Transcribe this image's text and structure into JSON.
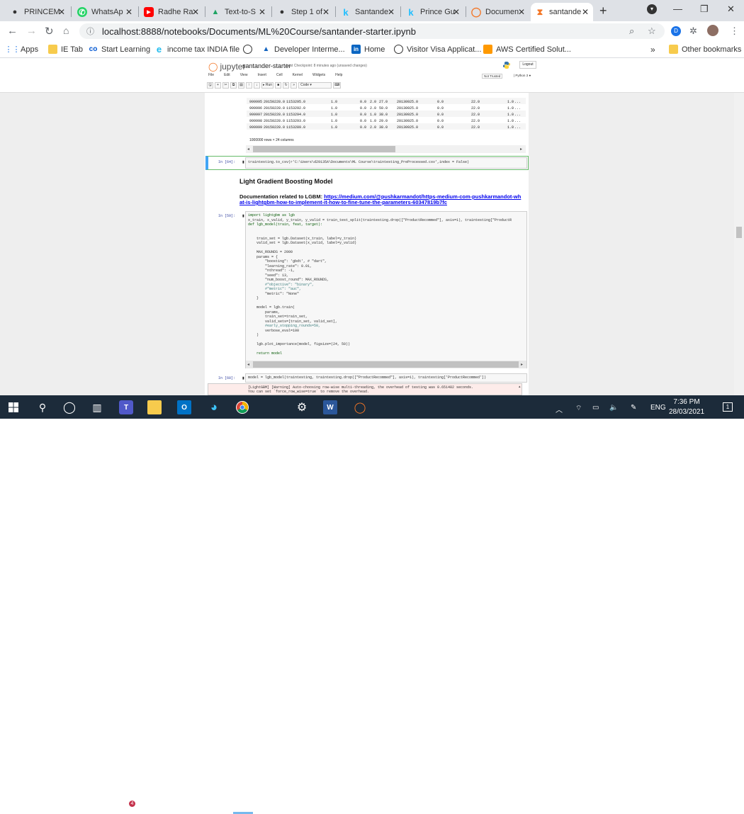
{
  "browser": {
    "tabs": [
      {
        "title": "PRINCEM",
        "icon": "github-icon"
      },
      {
        "title": "WhatsAp",
        "icon": "whatsapp-icon"
      },
      {
        "title": "Radhe Ra",
        "icon": "youtube-icon"
      },
      {
        "title": "Text-to-S",
        "icon": "google-drive-icon"
      },
      {
        "title": "Step 1 of",
        "icon": "github-icon"
      },
      {
        "title": "Santande",
        "icon": "kaggle-icon"
      },
      {
        "title": "Prince Gu",
        "icon": "kaggle-icon"
      },
      {
        "title": "Documen",
        "icon": "jupyter-icon"
      },
      {
        "title": "santande",
        "icon": "hourglass-icon"
      }
    ],
    "new_tab": "+",
    "url": "localhost:8888/notebooks/Documents/ML%20Course/santander-starter.ipynb",
    "profile_initial": "D",
    "bookmarks": [
      {
        "label": "Apps",
        "icon": "apps-grid-icon"
      },
      {
        "label": "IE Tab",
        "icon": "folder-icon"
      },
      {
        "label": "Start Learning",
        "icon": "coursera-icon"
      },
      {
        "label": "income tax INDIA file",
        "icon": "ie-icon"
      },
      {
        "label": "",
        "icon": "globe-icon"
      },
      {
        "label": "Developer Interme...",
        "icon": "developer-icon"
      },
      {
        "label": "Home",
        "icon": "linkedin-icon"
      },
      {
        "label": "Visitor Visa Applicat...",
        "icon": "globe-icon"
      },
      {
        "label": "AWS Certified Solut...",
        "icon": "aws-icon"
      }
    ],
    "more_bookmarks": "»",
    "other_bookmarks": "Other bookmarks"
  },
  "jupyter": {
    "logo_text": "jupyter",
    "notebook_name": "santander-starter",
    "checkpoint": "Last Checkpoint: 8 minutes ago  (unsaved changes)",
    "logout": "Logout",
    "menu": [
      "File",
      "Edit",
      "View",
      "Insert",
      "Cell",
      "Kernel",
      "Widgets",
      "Help"
    ],
    "trusted": "Not Trusted",
    "kernel": "Python 3",
    "toolbar": {
      "run": "Run",
      "cell_type": "Code"
    }
  },
  "dataframe": {
    "rows": [
      [
        "999995",
        "20150228.0",
        "1153295.0",
        "1.0",
        "0.0",
        "2.0",
        "27.0",
        "20130925.0",
        "0.0",
        "22.0",
        "1.0",
        "..."
      ],
      [
        "999996",
        "20150228.0",
        "1153292.0",
        "1.0",
        "0.0",
        "2.0",
        "50.0",
        "20130925.0",
        "0.0",
        "22.0",
        "1.0",
        "..."
      ],
      [
        "999997",
        "20150228.0",
        "1153294.0",
        "1.0",
        "0.0",
        "1.0",
        "38.0",
        "20130925.0",
        "0.0",
        "22.0",
        "1.0",
        "..."
      ],
      [
        "999998",
        "20150228.0",
        "1153293.0",
        "1.0",
        "0.0",
        "1.0",
        "29.0",
        "20130925.0",
        "0.0",
        "22.0",
        "1.0",
        "..."
      ],
      [
        "999999",
        "20150228.0",
        "1153289.0",
        "1.0",
        "0.0",
        "2.0",
        "38.0",
        "20130925.0",
        "0.0",
        "22.0",
        "1.0",
        "..."
      ]
    ],
    "shape_text": "1000000 rows × 24 columns"
  },
  "cells": {
    "c64_prompt": "In [64]:",
    "c64_code": "traintesting.to_csv(r'C:\\Users\\d29135A\\Documents\\ML Course\\traintesting_PreProcessed.csv',index = False)",
    "heading": "Light Gradient Boosting Model",
    "doc_label": "Documentation related to LGBM: ",
    "doc_link": "https://medium.com/@pushkarmandot/https-medium-com-pushkarmandot-what-is-lightgbm-how-to-implement-it-how-to-fine-tune-the-parameters-60347819b7fc",
    "c59_prompt": "In [59]:",
    "c59_lines": [
      "import lightgbm as lgb",
      "x_train, x_valid, y_train, y_valid = train_test_split(traintesting.drop([\"ProductRecommed\"], axis=1), traintesting[\"ProductR",
      "def lgb_model(train, feat, target):",
      "",
      "",
      "    train_set = lgb.Dataset(x_train, label=y_train)",
      "    valid_set = lgb.Dataset(x_valid, label=y_valid)",
      "",
      "    MAX_ROUNDS = 2000",
      "    params = {",
      "        \"boosting\": 'gbdt', # \"dart\",",
      "        \"learning_rate\": 0.01,",
      "        \"nthread\": -1,",
      "        \"seed\": 13,",
      "        \"num_boost_round\": MAX_ROUNDS,",
      "        #\"objective\": \"binary\",",
      "        #\"metric\": \"auc\",",
      "        \"metric\": \"None\"",
      "    }",
      "",
      "    model = lgb.train(",
      "        params,",
      "        train_set=train_set,",
      "        valid_sets=[train_set, valid_set],",
      "        #early_stopping_rounds=50,",
      "        verbose_eval=100",
      "    )",
      "",
      "    lgb.plot_importance(model, figsize=(24, 50))",
      "",
      "    return model"
    ],
    "c60_prompt": "In [60]:",
    "c60_code": "model = lgb_model(traintesting, traintesting.drop([\"ProductRecommed\"], axis=1), traintesting['ProductRecommed'])",
    "warning_lines": [
      "[LightGBM] [Warning] Auto-choosing row-wise multi-threading, the overhead of testing was 0.651482 seconds.",
      "You can set `force_row_wise=true` to remove the overhead."
    ]
  },
  "taskbar": {
    "time": "7:36 PM",
    "date": "28/03/2021",
    "lang": "ENG",
    "notifications": "1",
    "teams_badge": "4"
  },
  "colors": {
    "accent_jupyter": "#f37626",
    "taskbar": "#1c2b3a",
    "link": "#0000ee"
  }
}
